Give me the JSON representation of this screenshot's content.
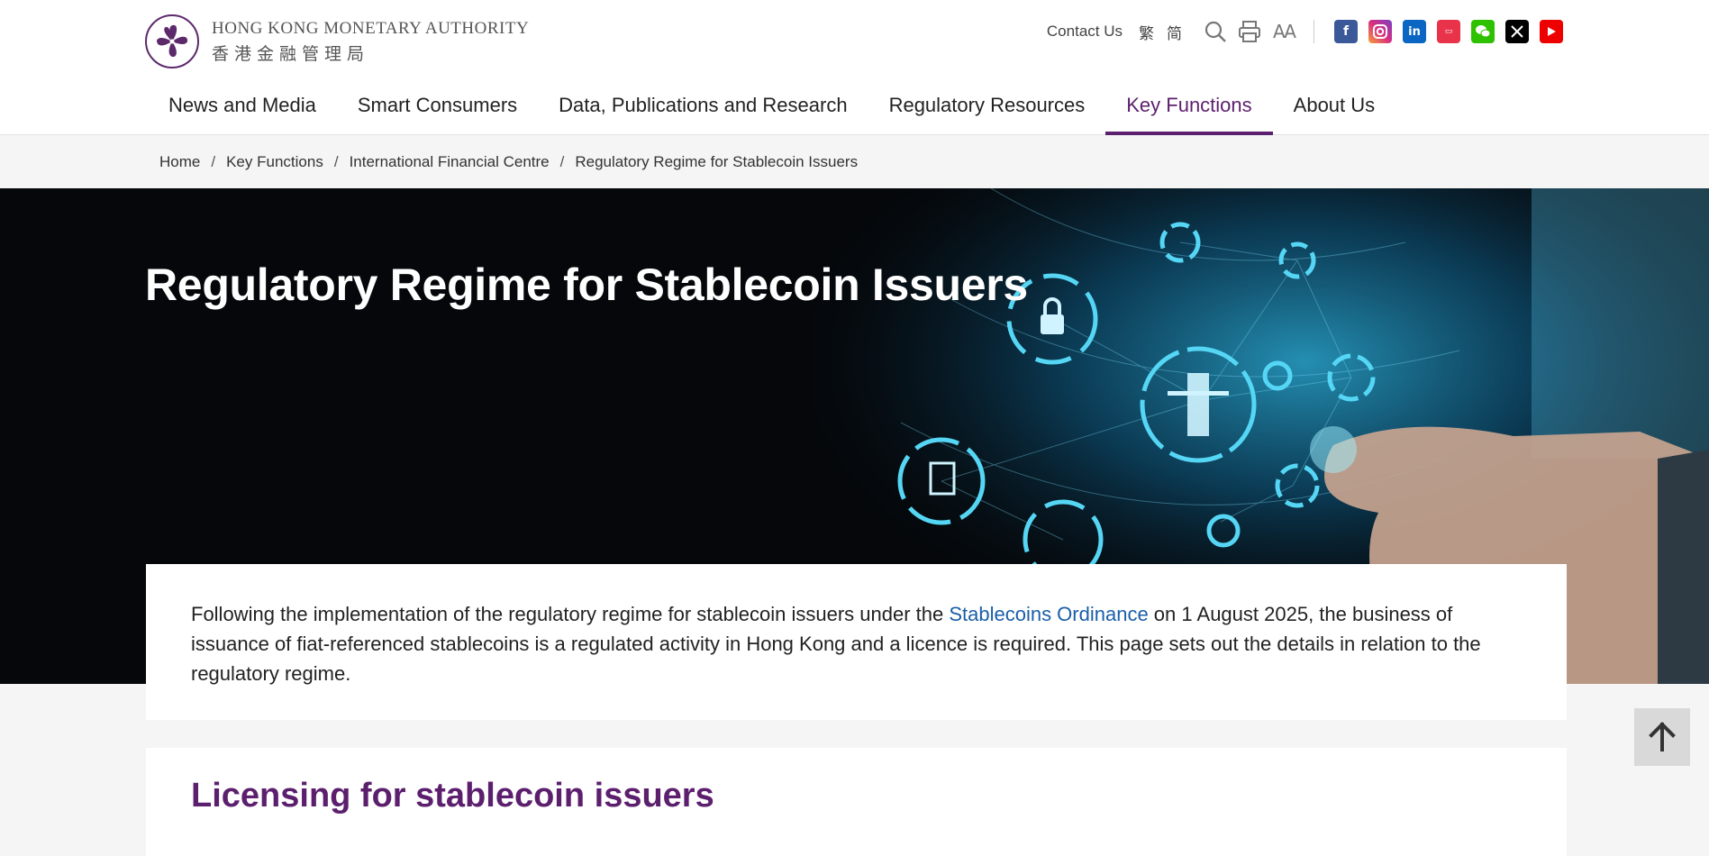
{
  "logo": {
    "name_en": "HONG KONG MONETARY AUTHORITY",
    "name_zh": "香港金融管理局"
  },
  "utility": {
    "contact": "Contact Us",
    "lang_trad": "繁",
    "lang_simp": "简",
    "font_size_label": "AA"
  },
  "nav": {
    "items": [
      {
        "label": "News and Media"
      },
      {
        "label": "Smart Consumers"
      },
      {
        "label": "Data, Publications and Research"
      },
      {
        "label": "Regulatory Resources"
      },
      {
        "label": "Key Functions"
      },
      {
        "label": "About Us"
      }
    ],
    "active_index": 4
  },
  "breadcrumb": {
    "items": [
      "Home",
      "Key Functions",
      "International Financial Centre",
      "Regulatory Regime for Stablecoin Issuers"
    ],
    "separator": "/"
  },
  "hero": {
    "title": "Regulatory Regime for Stablecoin Issuers"
  },
  "intro": {
    "text_before": "Following the implementation of the regulatory regime for stablecoin issuers under the ",
    "link": "Stablecoins Ordinance",
    "text_after": " on 1 August 2025, the business of issuance of fiat-referenced stablecoins is a regulated activity in Hong Kong and a licence is required.  This page sets out the details in relation to the regulatory regime."
  },
  "section": {
    "heading": "Licensing for stablecoin issuers"
  },
  "colors": {
    "brand_purple": "#5c1f6e",
    "link_blue": "#1a5fa8",
    "hero_glow": "#3fd0f0"
  },
  "icons": {
    "social": [
      "facebook-icon",
      "instagram-icon",
      "linkedin-icon",
      "weibo-icon",
      "wechat-icon",
      "x-icon",
      "youtube-icon"
    ]
  }
}
